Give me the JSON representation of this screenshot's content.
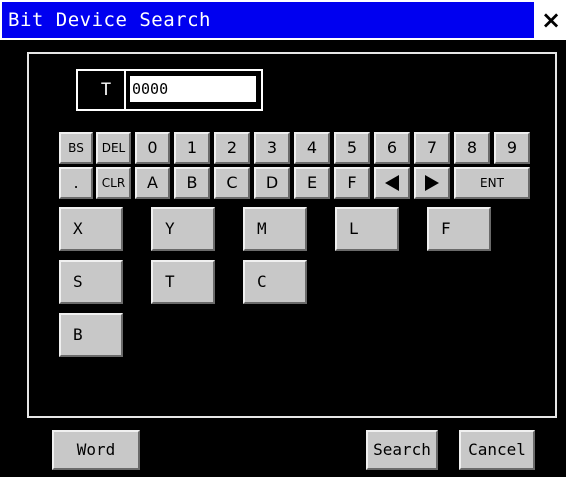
{
  "window": {
    "title": "Bit Device Search",
    "close_label": "×"
  },
  "entry": {
    "device_type": "T",
    "value": "0000"
  },
  "keypad": {
    "row1": [
      "BS",
      "DEL",
      "0",
      "1",
      "2",
      "3",
      "4",
      "5",
      "6",
      "7",
      "8",
      "9"
    ],
    "row2": [
      ".",
      "CLR",
      "A",
      "B",
      "C",
      "D",
      "E",
      "F",
      "",
      "",
      "ENT"
    ]
  },
  "devices": [
    "X",
    "Y",
    "M",
    "L",
    "F",
    "S",
    "T",
    "C",
    "B"
  ],
  "footer": {
    "word_label": "Word",
    "search_label": "Search",
    "cancel_label": "Cancel"
  }
}
